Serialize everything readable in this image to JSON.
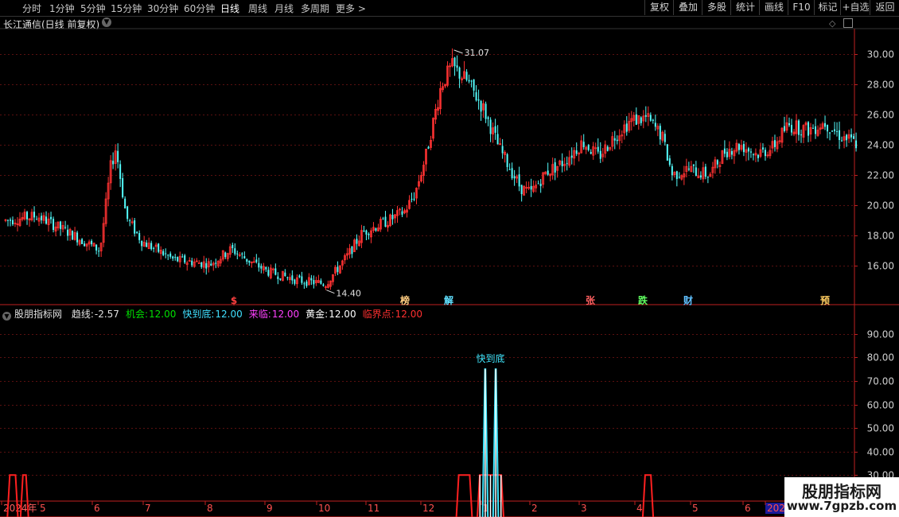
{
  "toolbar": {
    "periods": [
      "分时",
      "1分钟",
      "5分钟",
      "15分钟",
      "30分钟",
      "60分钟",
      "日线",
      "周线",
      "月线",
      "多周期",
      "更多 >"
    ],
    "active": "日线",
    "buttons": [
      "复权",
      "叠加",
      "多股",
      "统计",
      "画线",
      "F10",
      "标记",
      "+自选",
      "返回"
    ]
  },
  "main_title": "长江通信(日线 前复权)",
  "indicator": {
    "name": "股朋指标网",
    "items": [
      {
        "label": "趋线:",
        "value": "-2.57",
        "color": "#e0e0e0"
      },
      {
        "label": "机会:",
        "value": "12.00",
        "color": "#00e000"
      },
      {
        "label": "快到底:",
        "value": "12.00",
        "color": "#40e0ff"
      },
      {
        "label": "来临:",
        "value": "12.00",
        "color": "#ff40ff"
      },
      {
        "label": "黄金:",
        "value": "12.00",
        "color": "#ffffff"
      },
      {
        "label": "临界点:",
        "value": "12.00",
        "color": "#ff3030"
      }
    ],
    "signal_text": "快到底"
  },
  "colors": {
    "up": "#ff3232",
    "down": "#54fcfc",
    "grid": "#5a1010",
    "axis": "#c02020"
  },
  "x_axis_labels": [
    "2024年",
    "5",
    "6",
    "7",
    "8",
    "9",
    "10",
    "11",
    "12",
    "1",
    "2",
    "3",
    "4",
    "5",
    "6",
    "2025"
  ],
  "event_markers": [
    {
      "text": "$",
      "date_index": 1,
      "color": "#ff4040"
    },
    {
      "text": "榜",
      "date_index": 2,
      "color": "#ffcc80"
    },
    {
      "text": "解",
      "date_index": 3,
      "color": "#60e0ff"
    },
    {
      "text": "张",
      "date_index": 4,
      "color": "#ff6060"
    },
    {
      "text": "跌",
      "date_index": 5,
      "color": "#60ff60"
    },
    {
      "text": "财",
      "date_index": 6,
      "color": "#60c0ff"
    },
    {
      "text": "预",
      "date_index": 7,
      "color": "#ffcc60"
    }
  ],
  "watermark": {
    "title": "股朋指标网",
    "url": "www.7gpzb.com"
  },
  "chart_data": [
    {
      "type": "candlestick",
      "title": "长江通信(日线 前复权)",
      "ylim": [
        14,
        31.5
      ],
      "yticks": [
        16.0,
        18.0,
        20.0,
        22.0,
        24.0,
        26.0,
        28.0,
        30.0
      ],
      "high_label": "31.07",
      "low_label": "14.40",
      "anchors": [
        {
          "m": 0.0,
          "p": 19.0
        },
        {
          "m": 0.6,
          "p": 19.3
        },
        {
          "m": 1.2,
          "p": 18.2
        },
        {
          "m": 1.8,
          "p": 17.0
        },
        {
          "m": 2.0,
          "p": 22.5
        },
        {
          "m": 2.1,
          "p": 23.8
        },
        {
          "m": 2.3,
          "p": 19.2
        },
        {
          "m": 2.6,
          "p": 17.6
        },
        {
          "m": 3.2,
          "p": 16.4
        },
        {
          "m": 3.9,
          "p": 16.1
        },
        {
          "m": 4.3,
          "p": 17.1
        },
        {
          "m": 4.6,
          "p": 16.4
        },
        {
          "m": 5.0,
          "p": 15.6
        },
        {
          "m": 5.6,
          "p": 15.0
        },
        {
          "m": 6.1,
          "p": 14.8
        },
        {
          "m": 6.5,
          "p": 16.6
        },
        {
          "m": 6.8,
          "p": 18.2
        },
        {
          "m": 7.3,
          "p": 19.0
        },
        {
          "m": 7.6,
          "p": 19.6
        },
        {
          "m": 7.8,
          "p": 20.8
        },
        {
          "m": 8.0,
          "p": 23.2
        },
        {
          "m": 8.3,
          "p": 28.0
        },
        {
          "m": 8.5,
          "p": 29.2
        },
        {
          "m": 8.8,
          "p": 28.2
        },
        {
          "m": 9.1,
          "p": 26.4
        },
        {
          "m": 9.4,
          "p": 23.8
        },
        {
          "m": 9.8,
          "p": 21.2
        },
        {
          "m": 10.0,
          "p": 20.8
        },
        {
          "m": 10.3,
          "p": 22.2
        },
        {
          "m": 10.6,
          "p": 22.8
        },
        {
          "m": 11.0,
          "p": 24.2
        },
        {
          "m": 11.3,
          "p": 23.2
        },
        {
          "m": 11.6,
          "p": 24.6
        },
        {
          "m": 11.9,
          "p": 25.6
        },
        {
          "m": 12.2,
          "p": 25.8
        },
        {
          "m": 12.5,
          "p": 24.6
        },
        {
          "m": 12.7,
          "p": 22.0
        },
        {
          "m": 13.0,
          "p": 22.4
        },
        {
          "m": 13.4,
          "p": 22.0
        },
        {
          "m": 13.7,
          "p": 23.6
        },
        {
          "m": 14.0,
          "p": 24.0
        },
        {
          "m": 14.3,
          "p": 23.4
        },
        {
          "m": 14.6,
          "p": 23.8
        },
        {
          "m": 14.9,
          "p": 25.3
        },
        {
          "m": 15.3,
          "p": 25.0
        },
        {
          "m": 15.6,
          "p": 25.5
        },
        {
          "m": 15.9,
          "p": 24.6
        },
        {
          "m": 16.2,
          "p": 24.1
        }
      ]
    },
    {
      "type": "line",
      "ylim": [
        25,
        95
      ],
      "yticks": [
        30.0,
        40.0,
        50.0,
        60.0,
        70.0,
        80.0,
        90.0
      ],
      "baseline": 12,
      "series": [
        {
          "name": "临界点",
          "color": "#ff2020",
          "pulses": [
            [
              0.05,
              0.25,
              30
            ],
            [
              0.3,
              0.45,
              30
            ],
            [
              8.6,
              8.9,
              30
            ],
            [
              9.0,
              9.5,
              30
            ],
            [
              12.15,
              12.35,
              30
            ]
          ]
        },
        {
          "name": "快到底",
          "color": "#40e8ff",
          "pulses": [
            [
              9.1,
              9.2,
              75
            ],
            [
              9.3,
              9.4,
              75
            ]
          ]
        }
      ]
    }
  ]
}
